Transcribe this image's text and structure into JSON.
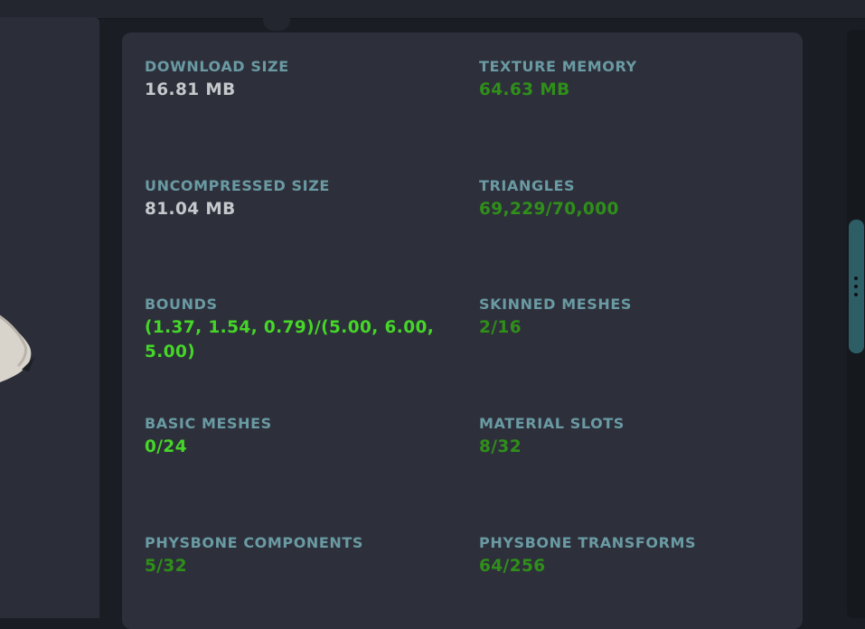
{
  "stats": [
    {
      "label": "DOWNLOAD SIZE",
      "value": "16.81 MB",
      "status": "neutral"
    },
    {
      "label": "TEXTURE MEMORY",
      "value": "64.63 MB",
      "status": "good"
    },
    {
      "label": "UNCOMPRESSED SIZE",
      "value": "81.04 MB",
      "status": "neutral"
    },
    {
      "label": "TRIANGLES",
      "value": "69,229/70,000",
      "status": "good"
    },
    {
      "label": "BOUNDS",
      "value": "(1.37, 1.54, 0.79)/(5.00, 6.00, 5.00)",
      "status": "excellent"
    },
    {
      "label": "SKINNED MESHES",
      "value": "2/16",
      "status": "good"
    },
    {
      "label": "BASIC MESHES",
      "value": "0/24",
      "status": "excellent"
    },
    {
      "label": "MATERIAL SLOTS",
      "value": "8/32",
      "status": "good"
    },
    {
      "label": "PHYSBONE COMPONENTS",
      "value": "5/32",
      "status": "good"
    },
    {
      "label": "PHYSBONE TRANSFORMS",
      "value": "64/256",
      "status": "good"
    }
  ],
  "colors": {
    "label": "#6a9aa3",
    "neutral": "#c6c8cc",
    "good": "#2f8f19",
    "excellent": "#45d628",
    "card": "#2d303b",
    "scroll_thumb": "#2d5e66"
  },
  "icons": {
    "scroll_grip": "vertical-ellipsis-icon",
    "avatar_preview": "avatar-tail-fragment"
  }
}
